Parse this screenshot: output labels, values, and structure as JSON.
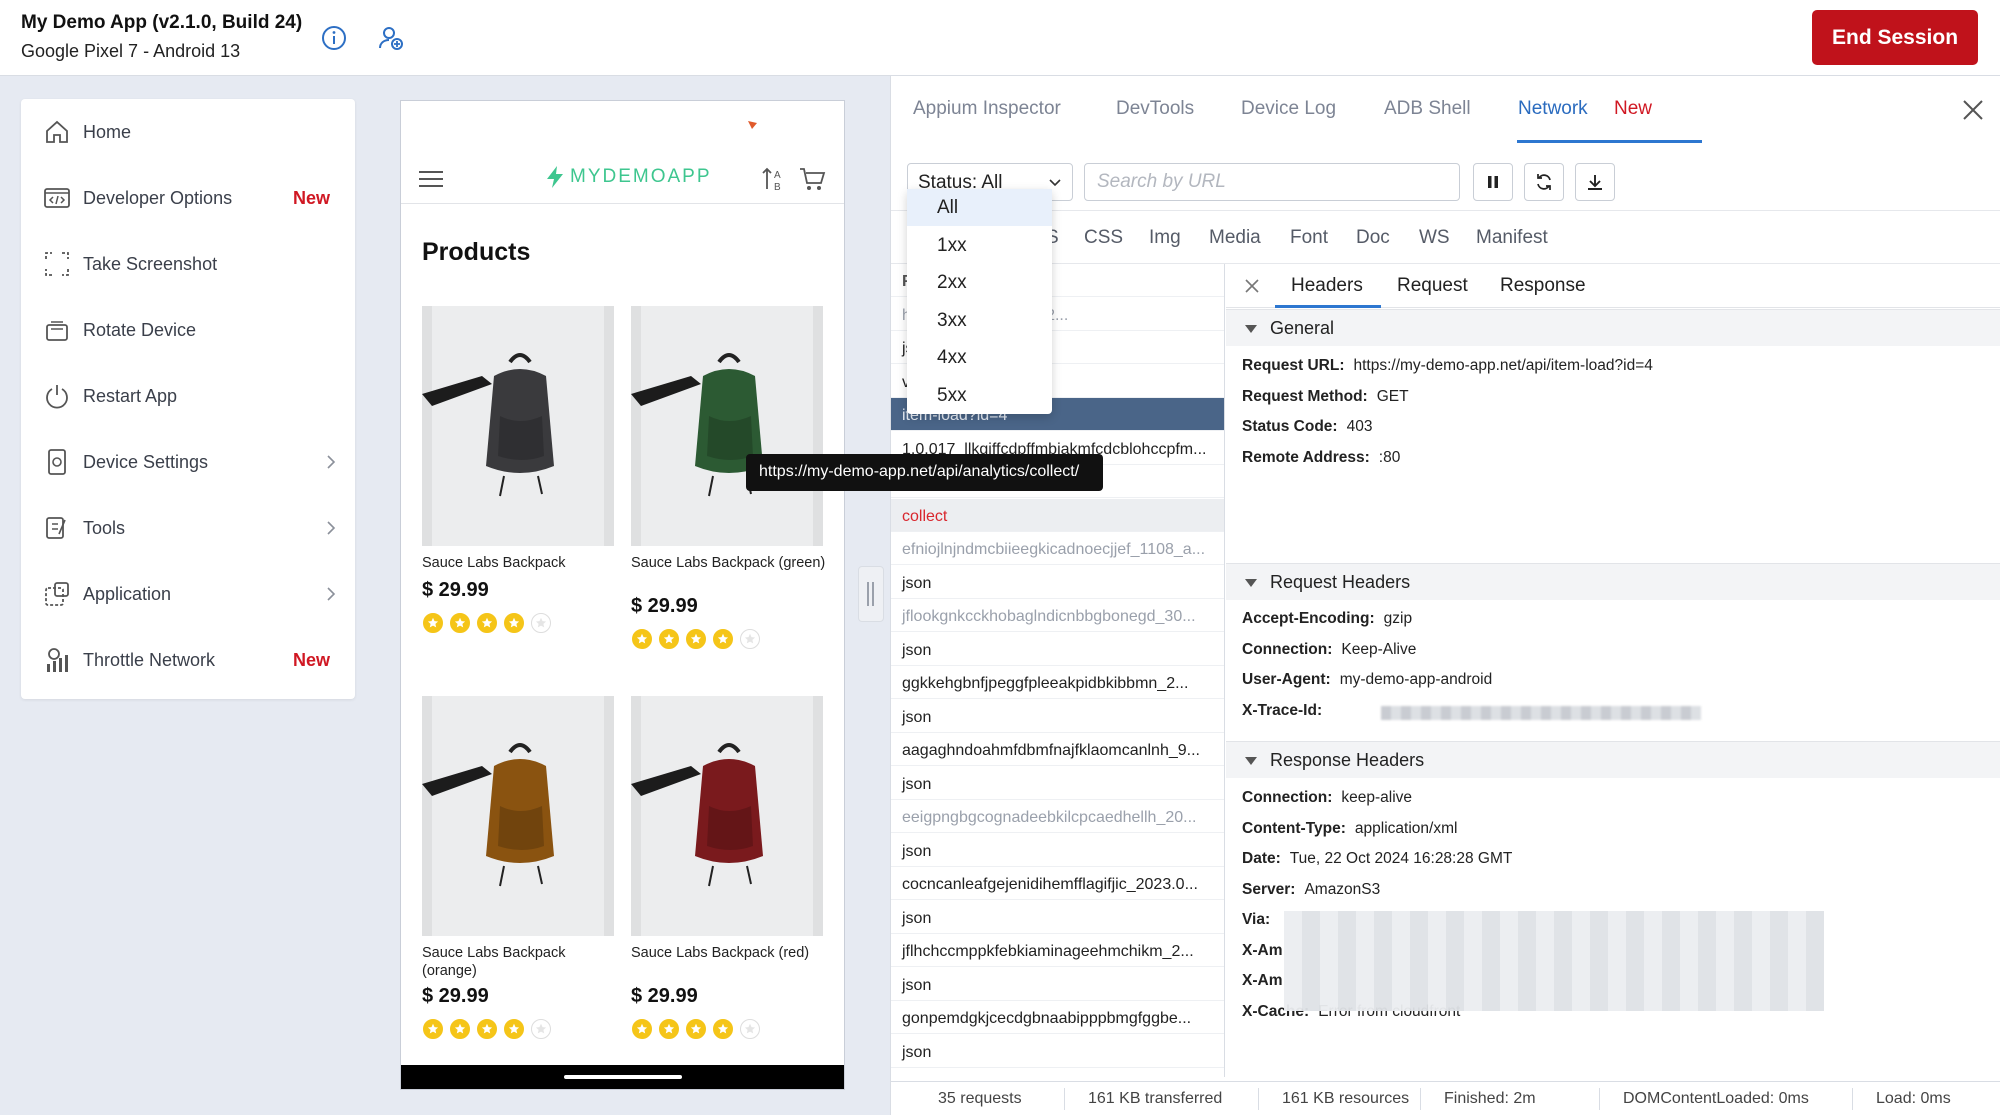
{
  "topbar": {
    "app_title": "My Demo App (v2.1.0, Build 24)",
    "device": "Google Pixel 7 - Android 13",
    "info_icon": "info-icon",
    "share_icon": "person-add-icon",
    "end_session": "End Session",
    "end_session_color": "#c0121b"
  },
  "sidebar": {
    "items": [
      {
        "label": "Home",
        "icon": "home-icon"
      },
      {
        "label": "Developer Options",
        "icon": "code-window-icon",
        "badge": "New"
      },
      {
        "label": "Take Screenshot",
        "icon": "screenshot-icon"
      },
      {
        "label": "Rotate Device",
        "icon": "rotate-device-icon"
      },
      {
        "label": "Restart App",
        "icon": "power-icon"
      },
      {
        "label": "Device Settings",
        "icon": "device-settings-icon"
      },
      {
        "label": "Tools",
        "icon": "tools-icon"
      },
      {
        "label": "Application",
        "icon": "application-icon"
      },
      {
        "label": "Throttle Network",
        "icon": "network-icon",
        "badge": "New"
      }
    ],
    "badge_color": "#d01823"
  },
  "phone": {
    "logo_a": "MY",
    "logo_b": "DEMOAPP",
    "title": "Products",
    "products": [
      {
        "name": "Sauce Labs Backpack",
        "price": "$ 29.99",
        "color": "#3a3a3d",
        "rating": 4
      },
      {
        "name": "Sauce Labs Backpack (green)",
        "price": "$ 29.99",
        "color": "#2c5a33",
        "rating": 4
      },
      {
        "name": "Sauce Labs Backpack (orange)",
        "price": "$ 29.99",
        "color": "#8a5310",
        "rating": 4
      },
      {
        "name": "Sauce Labs Backpack (red)",
        "price": "$ 29.99",
        "color": "#7a1a1d",
        "rating": 4
      }
    ]
  },
  "devtools": {
    "tabs": [
      "Appium Inspector",
      "DevTools",
      "Device Log",
      "ADB Shell",
      "Network"
    ],
    "network_badge": "New",
    "status_select": "Status: All",
    "search_placeholder": "Search by URL",
    "status_options": [
      "All",
      "1xx",
      "2xx",
      "3xx",
      "4xx",
      "5xx"
    ],
    "type_filters": [
      "S",
      "CSS",
      "Img",
      "Media",
      "Font",
      "Doc",
      "WS",
      "Manifest"
    ],
    "tooltip": "https://my-demo-app.net/api/analytics/collect/",
    "requests": [
      {
        "name": "F",
        "style": "header"
      },
      {
        "name": "h                    emjhofmfblmnib_92...",
        "style": "muted"
      },
      {
        "name": "js",
        "style": "normal"
      },
      {
        "name": "v",
        "style": "normal"
      },
      {
        "name": "item-load?id=4",
        "style": "selected"
      },
      {
        "name": "1.0.017_llkgiffcdpffmbiakmfcdcblohccpfm...",
        "style": "normal"
      },
      {
        "name": "",
        "style": "normal"
      },
      {
        "name": "collect",
        "style": "error"
      },
      {
        "name": "efniojlnjndmcbiieegkicadnoecjjef_1108_a...",
        "style": "muted"
      },
      {
        "name": "json",
        "style": "normal"
      },
      {
        "name": "jflookgnkcckhobaglndicnbbgbonegd_30...",
        "style": "muted"
      },
      {
        "name": "json",
        "style": "normal"
      },
      {
        "name": "ggkkehgbnfjpeggfpleeakpidbkibbmn_2...",
        "style": "normal"
      },
      {
        "name": "json",
        "style": "normal"
      },
      {
        "name": "aagaghndoahmfdbmfnajfklaomcanlnh_9...",
        "style": "normal"
      },
      {
        "name": "json",
        "style": "normal"
      },
      {
        "name": "eeigpngbgcognadeebkilcpcaedhellh_20...",
        "style": "muted"
      },
      {
        "name": "json",
        "style": "normal"
      },
      {
        "name": "cocncanleafgejenidihemfflagifjic_2023.0...",
        "style": "normal"
      },
      {
        "name": "json",
        "style": "normal"
      },
      {
        "name": "jflhchccmppkfebkiaminageehmchikm_2...",
        "style": "normal"
      },
      {
        "name": "json",
        "style": "normal"
      },
      {
        "name": "gonpemdgkjcecdgbnaabipppbmgfggbe...",
        "style": "normal"
      },
      {
        "name": "json",
        "style": "normal"
      }
    ],
    "detail_tabs": [
      "Headers",
      "Request",
      "Response"
    ],
    "general_title": "General",
    "general": [
      {
        "k": "Request URL:",
        "v": "https://my-demo-app.net/api/item-load?id=4"
      },
      {
        "k": "Request Method:",
        "v": "GET"
      },
      {
        "k": "Status Code:",
        "v": "403"
      },
      {
        "k": "Remote Address:",
        "v": ":80"
      }
    ],
    "req_headers_title": "Request Headers",
    "request_headers": [
      {
        "k": "Accept-Encoding:",
        "v": "gzip"
      },
      {
        "k": "Connection:",
        "v": "Keep-Alive"
      },
      {
        "k": "User-Agent:",
        "v": "my-demo-app-android"
      },
      {
        "k": "X-Trace-Id:",
        "v": ""
      }
    ],
    "resp_headers_title": "Response Headers",
    "response_headers": [
      {
        "k": "Connection:",
        "v": "keep-alive"
      },
      {
        "k": "Content-Type:",
        "v": "application/xml"
      },
      {
        "k": "Date:",
        "v": "Tue, 22 Oct 2024 16:28:28 GMT"
      },
      {
        "k": "Server:",
        "v": "AmazonS3"
      },
      {
        "k": "Via:",
        "v": ""
      },
      {
        "k": "X-Am",
        "v": ""
      },
      {
        "k": "X-Am",
        "v": ""
      },
      {
        "k": "X-Cache:",
        "v": "Error from cloudfront"
      }
    ],
    "status_bar": [
      "35 requests",
      "161 KB transferred",
      "161 KB resources",
      "Finished: 2m",
      "DOMContentLoaded: 0ms",
      "Load: 0ms"
    ],
    "accent": "#2d77d0",
    "selected_row_color": "#4a6588",
    "error_color": "#d9262d"
  }
}
